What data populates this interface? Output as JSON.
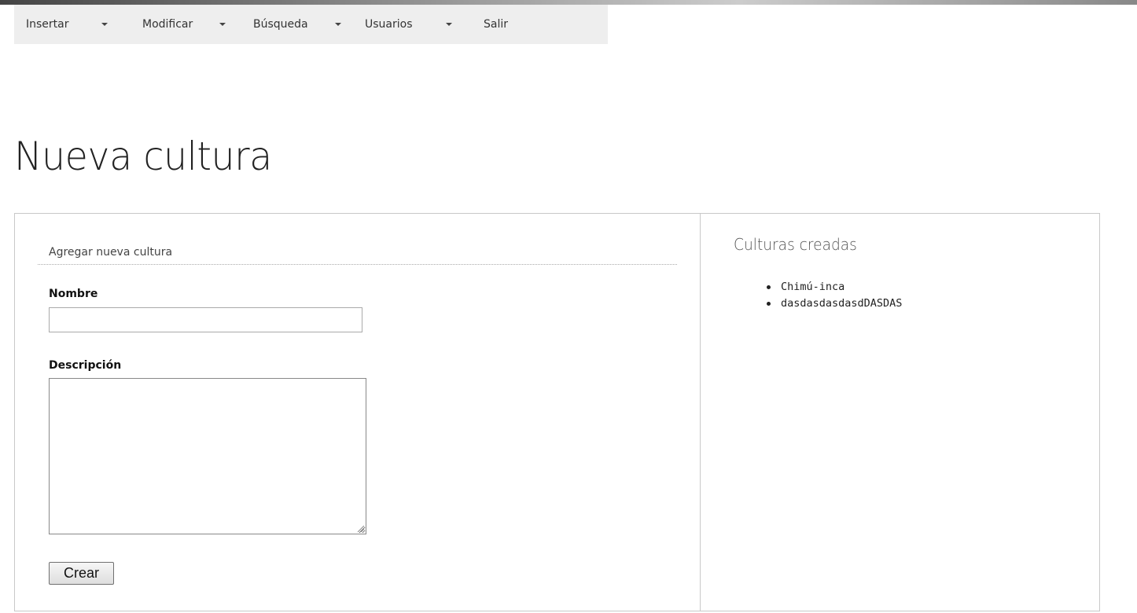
{
  "menu": {
    "items": [
      {
        "label": "Insertar",
        "has_dropdown": true
      },
      {
        "label": "Modificar",
        "has_dropdown": true
      },
      {
        "label": "Búsqueda",
        "has_dropdown": true
      },
      {
        "label": "Usuarios",
        "has_dropdown": true
      },
      {
        "label": "Salir",
        "has_dropdown": false
      }
    ]
  },
  "page": {
    "title": "Nueva cultura"
  },
  "form": {
    "heading": "Agregar nueva cultura",
    "nombre_label": "Nombre",
    "nombre_value": "",
    "descripcion_label": "Descripción",
    "descripcion_value": "",
    "submit_label": "Crear"
  },
  "sidebar": {
    "heading": "Culturas creadas",
    "items": [
      "Chimú-inca",
      "dasdasdasdasdDASDAS"
    ]
  },
  "colors": {
    "menubar_bg": "#eeeeee",
    "panel_border": "#c8c8c8"
  }
}
